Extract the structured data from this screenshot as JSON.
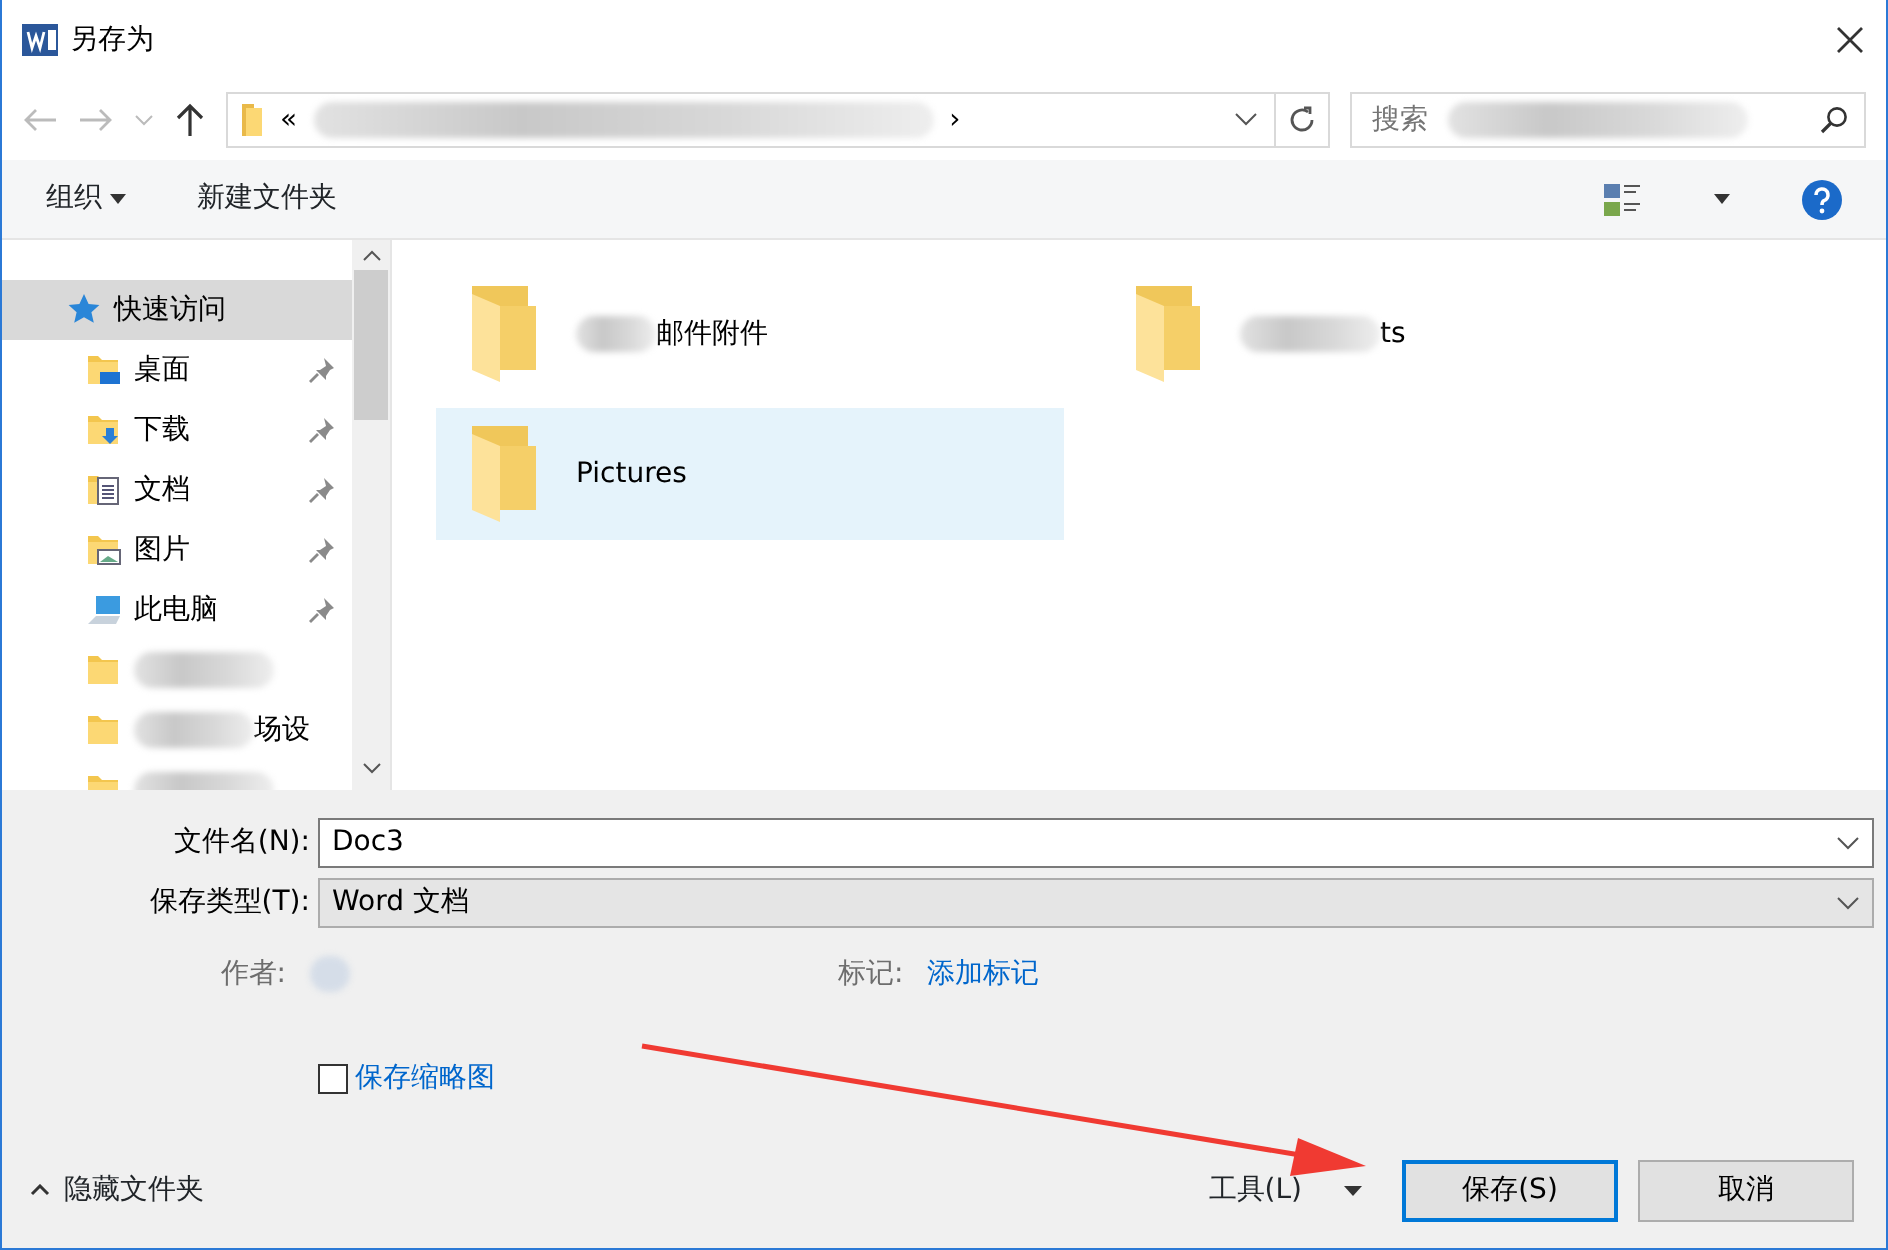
{
  "window": {
    "title": "另存为"
  },
  "address_bar": {
    "prefix": "«",
    "chevron": "›"
  },
  "search": {
    "placeholder": "搜索"
  },
  "toolbar": {
    "organize": "组织",
    "new_folder": "新建文件夹"
  },
  "sidebar": {
    "items": [
      {
        "label": "快速访问",
        "kind": "star",
        "selected": true,
        "children": [
          {
            "label": "桌面",
            "kind": "desktop",
            "pinned": true,
            "blurred": false
          },
          {
            "label": "下载",
            "kind": "download",
            "pinned": true,
            "blurred": false
          },
          {
            "label": "文档",
            "kind": "document",
            "pinned": true,
            "blurred": false
          },
          {
            "label": "图片",
            "kind": "image",
            "pinned": true,
            "blurred": false
          },
          {
            "label": "此电脑",
            "kind": "computer",
            "pinned": true,
            "blurred": false
          },
          {
            "kind": "folder",
            "pinned": false,
            "blurred": true
          },
          {
            "label": "场设",
            "kind": "folder",
            "pinned": false,
            "blurred": true
          },
          {
            "kind": "folder",
            "pinned": false,
            "blurred": true
          }
        ]
      }
    ]
  },
  "files": [
    {
      "name": "邮件附件",
      "blurred": true,
      "selected": false
    },
    {
      "name": "ts",
      "blurred": true,
      "selected": false
    },
    {
      "name": "Pictures",
      "blurred": false,
      "selected": true
    }
  ],
  "form": {
    "file_name_label": "文件名(N):",
    "file_name": "Doc3",
    "type_label": "保存类型(T):",
    "type": "Word 文档",
    "author_label": "作者:",
    "tags_label": "标记:",
    "tags_link": "添加标记",
    "thumbnail": {
      "label": "保存缩略图",
      "checked": false
    }
  },
  "footer": {
    "hide_folders": "隐藏文件夹",
    "tools": "工具(L)",
    "buttons": [
      {
        "label": "保存(S)",
        "kind": "primary"
      },
      {
        "label": "取消",
        "kind": "default"
      }
    ]
  }
}
